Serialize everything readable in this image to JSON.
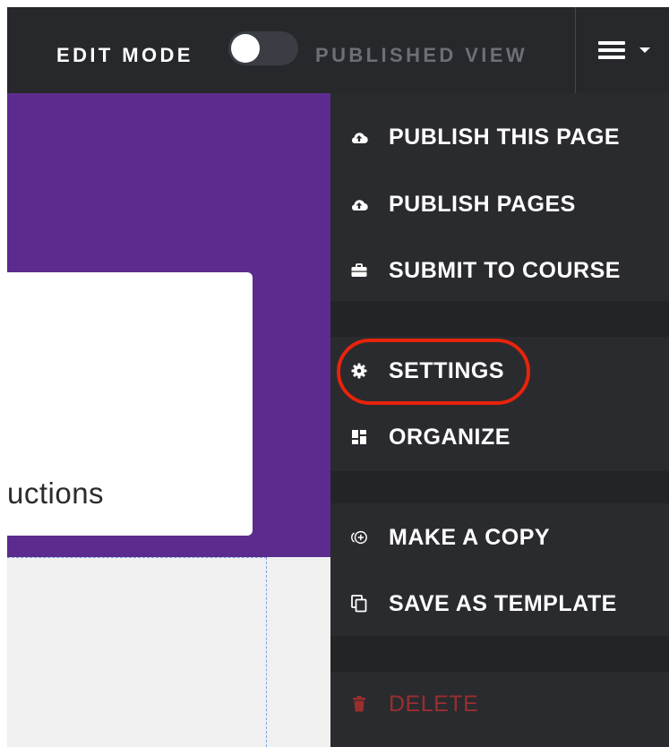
{
  "topbar": {
    "edit_mode_label": "EDIT MODE",
    "published_view_label": "PUBLISHED VIEW",
    "toggle_state": "off"
  },
  "page": {
    "card_text": "uctions",
    "hero_color": "#5b2c8e"
  },
  "menu": {
    "items": [
      {
        "label": "PUBLISH THIS PAGE",
        "icon": "cloud-upload-icon"
      },
      {
        "label": "PUBLISH PAGES",
        "icon": "cloud-upload-icon"
      },
      {
        "label": "SUBMIT TO COURSE",
        "icon": "briefcase-icon"
      },
      {
        "label": "SETTINGS",
        "icon": "gear-icon",
        "highlighted": true
      },
      {
        "label": "ORGANIZE",
        "icon": "dashboard-icon"
      },
      {
        "label": "MAKE A COPY",
        "icon": "copy-plus-icon"
      },
      {
        "label": "SAVE AS TEMPLATE",
        "icon": "copy-icon"
      },
      {
        "label": "DELETE",
        "icon": "trash-icon",
        "danger": true
      }
    ]
  },
  "colors": {
    "highlight": "#e8230c",
    "danger": "#9a2e2e",
    "topbar": "#26282b",
    "menu_bg": "#2a2b2e"
  }
}
